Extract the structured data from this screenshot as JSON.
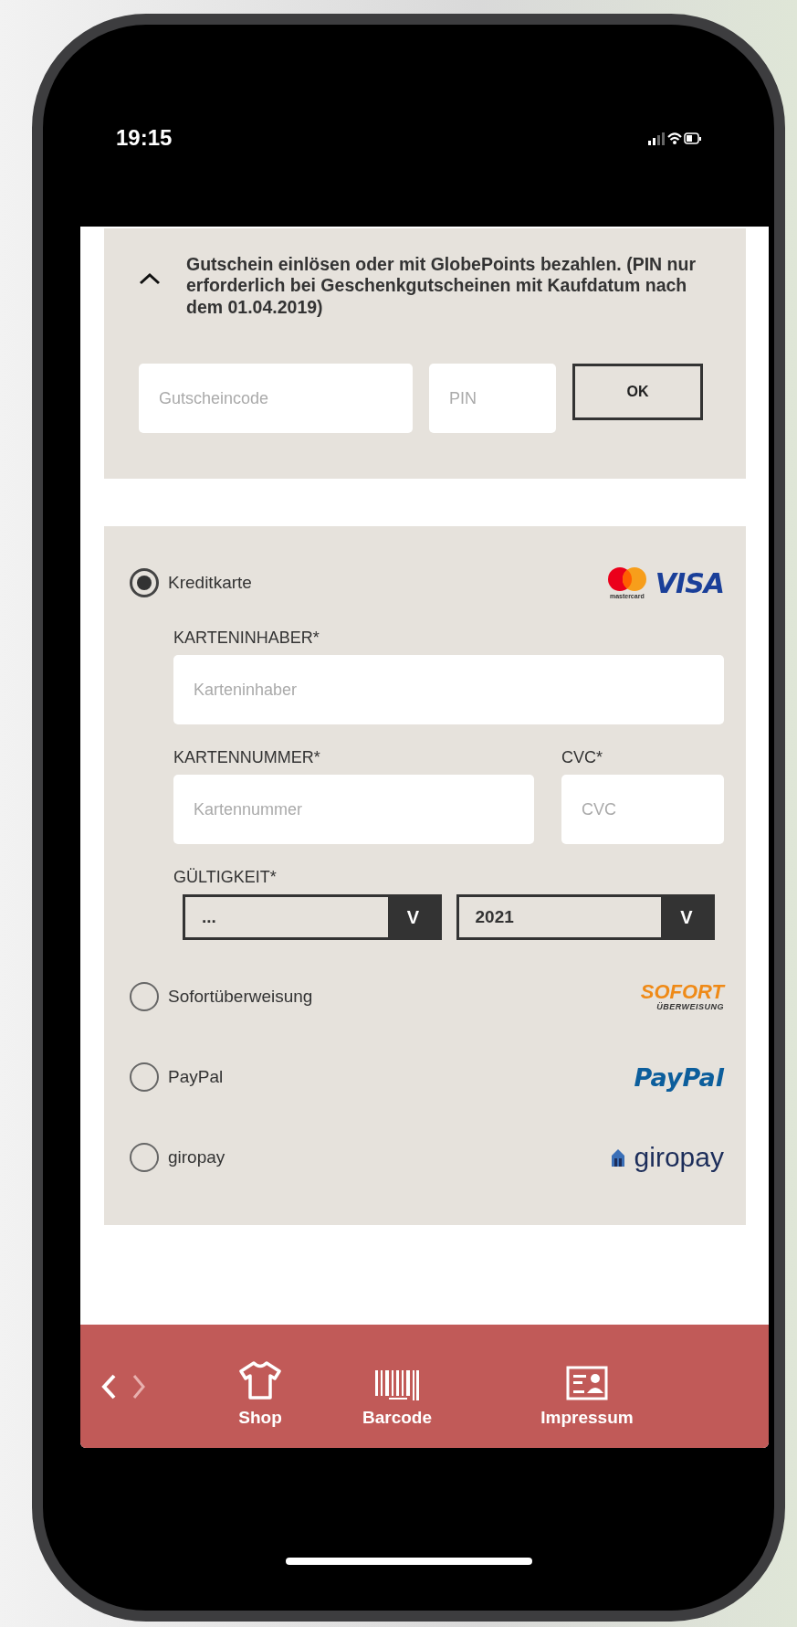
{
  "status_bar": {
    "time": "19:15"
  },
  "coupon": {
    "expanded": true,
    "text": "Gutschein einlösen oder mit GlobePoints bezahlen. (PIN nur erforderlich bei Geschenkgutscheinen mit Kaufdatum nach dem 01.04.2019)",
    "code_placeholder": "Gutscheincode",
    "pin_placeholder": "PIN",
    "button": "OK"
  },
  "payment_methods": [
    {
      "kind": "card",
      "label": "Kreditkarte",
      "selected": true,
      "logos": [
        "mastercard",
        "VISA"
      ],
      "fields": {
        "holder_label": "KARTENINHABER*",
        "holder_placeholder": "Karteninhaber",
        "number_label": "KARTENNUMMER*",
        "number_placeholder": "Kartennummer",
        "cvc_label": "CVC*",
        "cvc_placeholder": "CVC",
        "validity_label": "GÜLTIGKEIT*",
        "month_value": "...",
        "month_button": "V",
        "year_value": "2021",
        "year_button": "V"
      }
    },
    {
      "kind": "sofort",
      "label": "Sofortüberweisung",
      "selected": false,
      "logos": [
        "SOFORT",
        "ÜBERWEISUNG"
      ]
    },
    {
      "kind": "paypal",
      "label": "PayPal",
      "selected": false,
      "logos": [
        "PayPal"
      ]
    },
    {
      "kind": "giropay",
      "label": "giropay",
      "selected": false,
      "logos": [
        "giropay"
      ]
    }
  ],
  "nav_bar": {
    "items": [
      {
        "kind": "shirt",
        "label": "Shop"
      },
      {
        "kind": "barcode",
        "label": "Barcode"
      },
      {
        "kind": "card",
        "label": "Impressum"
      }
    ]
  }
}
